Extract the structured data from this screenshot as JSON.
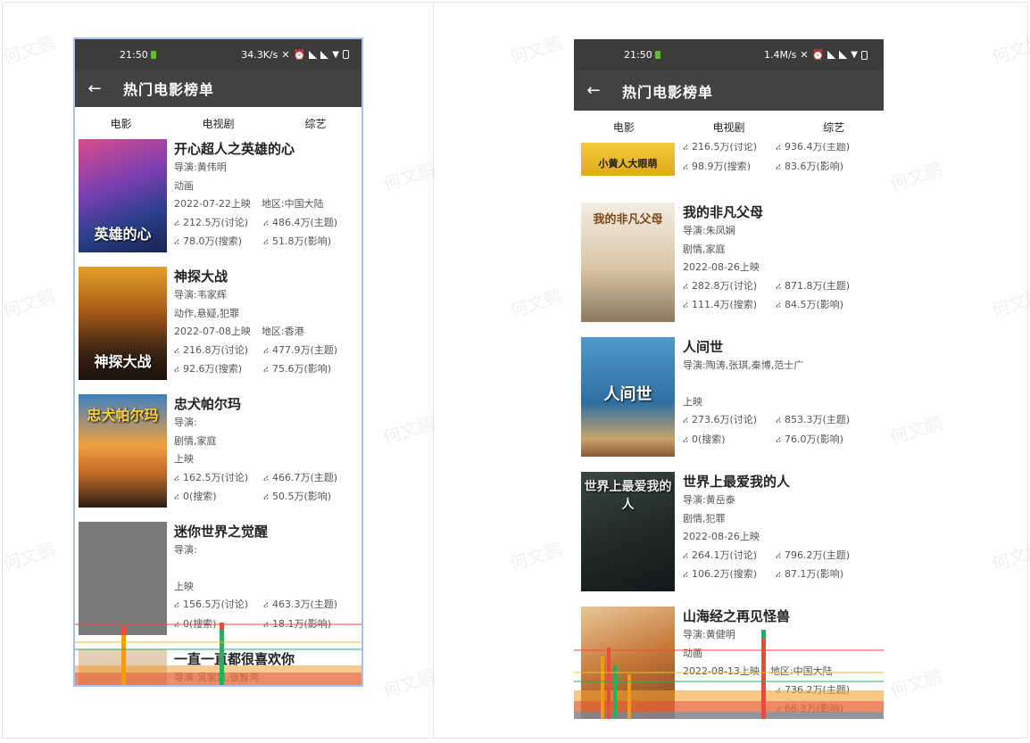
{
  "watermark_text": "何文鹏",
  "left_phone": {
    "status": {
      "time": "21:50",
      "speed": "34.3K/s"
    },
    "appbar": {
      "title": "热门电影榜单",
      "back_icon": "arrow-left-icon"
    },
    "tabs": [
      "电影",
      "电视剧",
      "综艺"
    ],
    "movies": [
      {
        "title": "开心超人之英雄的心",
        "director": "导演:黄伟明",
        "genre": "动画",
        "release": "2022-07-22上映",
        "region": "地区:中国大陆",
        "discuss": "212.5万(讨论)",
        "topic": "486.4万(主题)",
        "search": "78.0万(搜索)",
        "influence": "51.8万(影响)",
        "poster_text": "英雄的心"
      },
      {
        "title": "神探大战",
        "director": "导演:韦家辉",
        "genre": "动作,悬疑,犯罪",
        "release": "2022-07-08上映",
        "region": "地区:香港",
        "discuss": "216.8万(讨论)",
        "topic": "477.9万(主题)",
        "search": "92.6万(搜索)",
        "influence": "75.6万(影响)",
        "poster_text": "神探大战"
      },
      {
        "title": "忠犬帕尔玛",
        "director": "导演:",
        "genre": "剧情,家庭",
        "release": "上映",
        "region": "",
        "discuss": "162.5万(讨论)",
        "topic": "466.7万(主题)",
        "search": "0(搜索)",
        "influence": "50.5万(影响)",
        "poster_text": "忠犬帕尔玛"
      },
      {
        "title": "迷你世界之觉醒",
        "director": "导演:",
        "genre": "",
        "release": "上映",
        "region": "",
        "discuss": "156.5万(讨论)",
        "topic": "463.3万(主题)",
        "search": "0(搜索)",
        "influence": "18.1万(影响)",
        "poster_text": ""
      },
      {
        "title": "一直一直都很喜欢你",
        "director": "导演:吴家凯,张智鸿",
        "genre": "",
        "release": "",
        "region": "",
        "discuss": "",
        "topic": "",
        "search": "",
        "influence": "",
        "poster_text": ""
      }
    ]
  },
  "right_phone": {
    "status": {
      "time": "21:50",
      "speed": "1.4M/s"
    },
    "appbar": {
      "title": "热门电影榜单",
      "back_icon": "arrow-left-icon"
    },
    "tabs": [
      "电影",
      "电视剧",
      "综艺"
    ],
    "partial_top": {
      "discuss": "216.5万(讨论)",
      "topic": "936.4万(主题)",
      "search": "98.9万(搜索)",
      "influence": "83.6万(影响)",
      "poster_text": "小黄人大眼萌"
    },
    "movies": [
      {
        "title": "我的非凡父母",
        "director": "导演:朱凤娴",
        "genre": "剧情,家庭",
        "release": "2022-08-26上映",
        "region": "",
        "discuss": "282.8万(讨论)",
        "topic": "871.8万(主题)",
        "search": "111.4万(搜索)",
        "influence": "84.5万(影响)",
        "poster_text": "我的非凡父母"
      },
      {
        "title": "人间世",
        "director": "导演:陶涛,张琪,秦博,范士广",
        "genre": "",
        "release": "上映",
        "region": "",
        "discuss": "273.6万(讨论)",
        "topic": "853.3万(主题)",
        "search": "0(搜索)",
        "influence": "76.0万(影响)",
        "poster_text": "人间世"
      },
      {
        "title": "世界上最爱我的人",
        "director": "导演:黄岳泰",
        "genre": "剧情,犯罪",
        "release": "2022-08-26上映",
        "region": "",
        "discuss": "264.1万(讨论)",
        "topic": "796.2万(主题)",
        "search": "106.2万(搜索)",
        "influence": "87.1万(影响)",
        "poster_text": "世界上最爱我的人"
      },
      {
        "title": "山海经之再见怪兽",
        "director": "导演:黄健明",
        "genre": "动画",
        "release": "2022-08-13上映",
        "region": "地区:中国大陆",
        "discuss": "",
        "topic": "736.2万(主题)",
        "search": "",
        "influence": "66.3万(影响)",
        "poster_text": ""
      }
    ]
  },
  "colors": {
    "statusbar": "#3c3c3c",
    "appbar": "#424242",
    "highlight_border": "#a9c0f2"
  }
}
